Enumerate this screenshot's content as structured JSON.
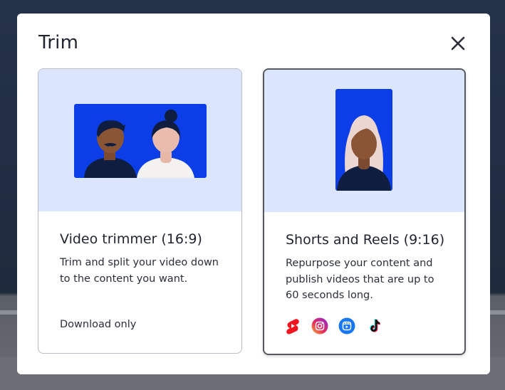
{
  "modal": {
    "title": "Trim",
    "close_icon": "close-icon"
  },
  "cards": [
    {
      "title": "Video trimmer (16:9)",
      "description": "Trim and split your video down to the content you want.",
      "footer": "Download only",
      "illustration": "two-people-landscape"
    },
    {
      "title": "Shorts and Reels (9:16)",
      "description": "Repurpose your content and publish videos that are up to 60 seconds long.",
      "illustration": "one-person-portrait",
      "platform_icons": [
        "youtube-shorts-icon",
        "instagram-icon",
        "facebook-reels-icon",
        "tiktok-icon"
      ]
    }
  ],
  "colors": {
    "hero_bg": "#dbe5fb",
    "illustration_blue": "#0b3ee6",
    "text_dark": "#1f2430"
  }
}
